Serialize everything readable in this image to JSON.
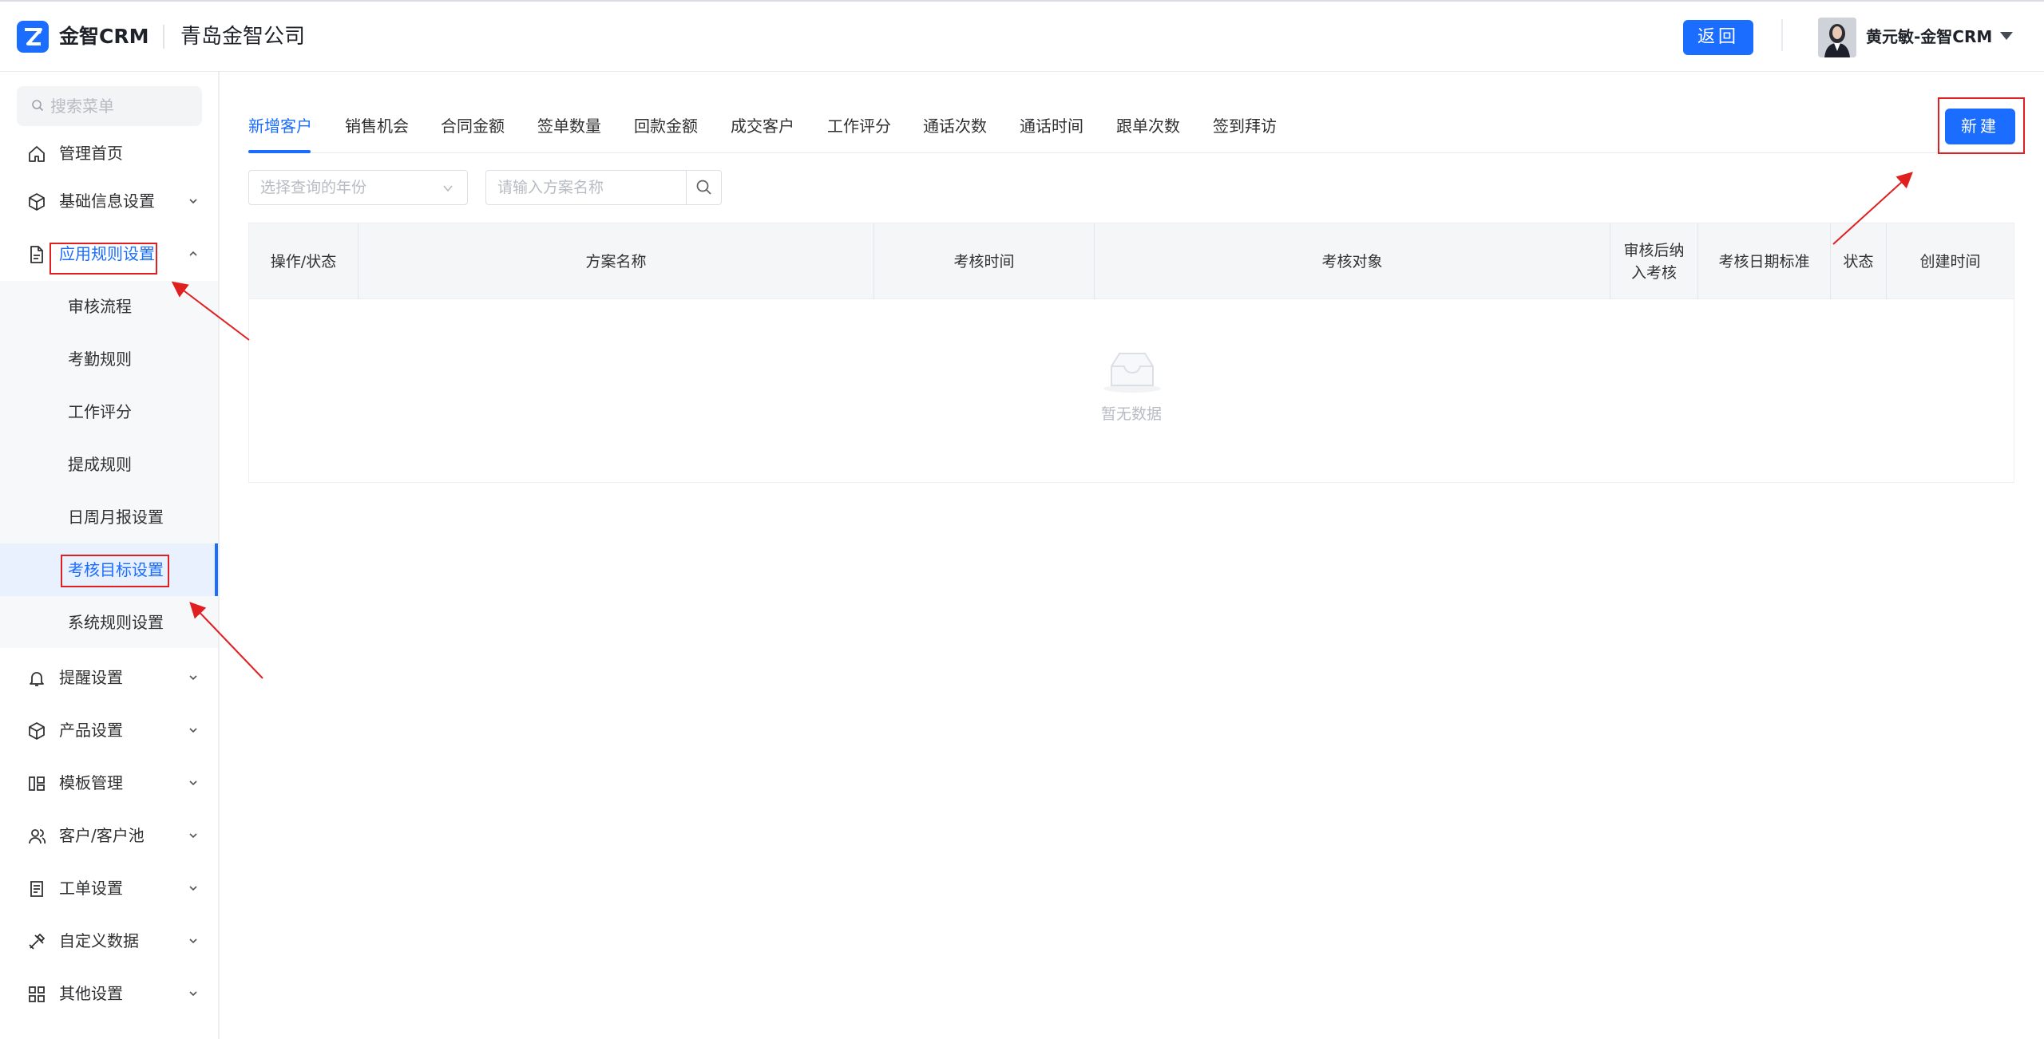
{
  "header": {
    "brand": "金智CRM",
    "company": "青岛金智公司",
    "back_label": "返回",
    "user_name": "黄元敏-金智CRM"
  },
  "sidebar": {
    "search_placeholder": "搜索菜单",
    "items": [
      {
        "label": "管理首页",
        "icon": "home-icon"
      },
      {
        "label": "基础信息设置",
        "icon": "cube-icon"
      },
      {
        "label": "应用规则设置",
        "icon": "document-icon",
        "expanded": true
      },
      {
        "label": "提醒设置",
        "icon": "bell-icon"
      },
      {
        "label": "产品设置",
        "icon": "box-icon"
      },
      {
        "label": "模板管理",
        "icon": "template-icon"
      },
      {
        "label": "客户/客户池",
        "icon": "users-icon"
      },
      {
        "label": "工单设置",
        "icon": "ticket-icon"
      },
      {
        "label": "自定义数据",
        "icon": "tools-icon"
      },
      {
        "label": "其他设置",
        "icon": "grid-icon"
      }
    ],
    "sub_items": [
      {
        "label": "审核流程"
      },
      {
        "label": "考勤规则"
      },
      {
        "label": "工作评分"
      },
      {
        "label": "提成规则"
      },
      {
        "label": "日周月报设置"
      },
      {
        "label": "考核目标设置",
        "active": true
      },
      {
        "label": "系统规则设置"
      }
    ]
  },
  "content": {
    "tabs": [
      {
        "label": "新增客户",
        "active": true
      },
      {
        "label": "销售机会"
      },
      {
        "label": "合同金额"
      },
      {
        "label": "签单数量"
      },
      {
        "label": "回款金额"
      },
      {
        "label": "成交客户"
      },
      {
        "label": "工作评分"
      },
      {
        "label": "通话次数"
      },
      {
        "label": "通话时间"
      },
      {
        "label": "跟单次数"
      },
      {
        "label": "签到拜访"
      }
    ],
    "new_label": "新建",
    "year_placeholder": "选择查询的年份",
    "name_placeholder": "请输入方案名称",
    "table": {
      "columns": [
        "操作/状态",
        "方案名称",
        "考核时间",
        "考核对象",
        "审核后纳入考核",
        "考核日期标准",
        "状态",
        "创建时间"
      ],
      "empty_text": "暂无数据"
    }
  },
  "colors": {
    "accent": "#1a6dff",
    "highlight_border": "#e02020",
    "sidebar_sub_bg": "#f7f8fa"
  }
}
